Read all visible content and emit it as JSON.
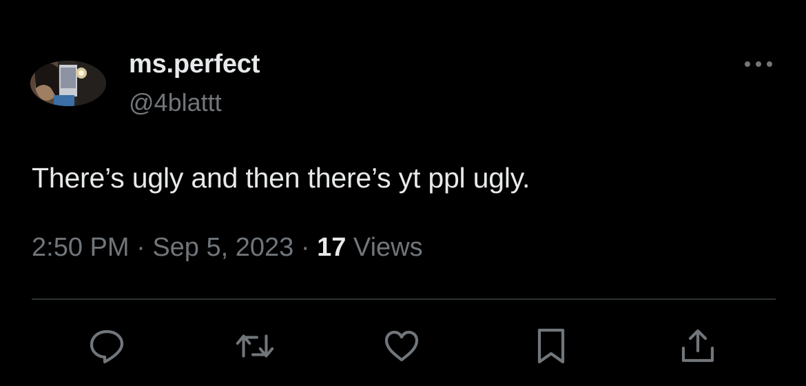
{
  "tweet": {
    "author": {
      "display_name": "ms.perfect",
      "handle": "@4blattt",
      "avatar": "avatar-photo"
    },
    "text": "There’s ugly and then there’s yt ppl ugly.",
    "time": "2:50 PM",
    "separator": "·",
    "date": "Sep 5, 2023",
    "views_count": "17",
    "views_label": "Views"
  },
  "actions": [
    {
      "name": "reply",
      "icon": "speech-bubble-icon"
    },
    {
      "name": "retweet",
      "icon": "retweet-icon"
    },
    {
      "name": "like",
      "icon": "heart-icon"
    },
    {
      "name": "bookmark",
      "icon": "bookmark-icon"
    },
    {
      "name": "share",
      "icon": "share-icon"
    }
  ],
  "more_menu": {
    "icon": "more-options-icon"
  },
  "colors": {
    "background": "#000000",
    "primary_text": "#e7e9ea",
    "secondary_text": "#71767b",
    "divider": "#2f3336"
  }
}
